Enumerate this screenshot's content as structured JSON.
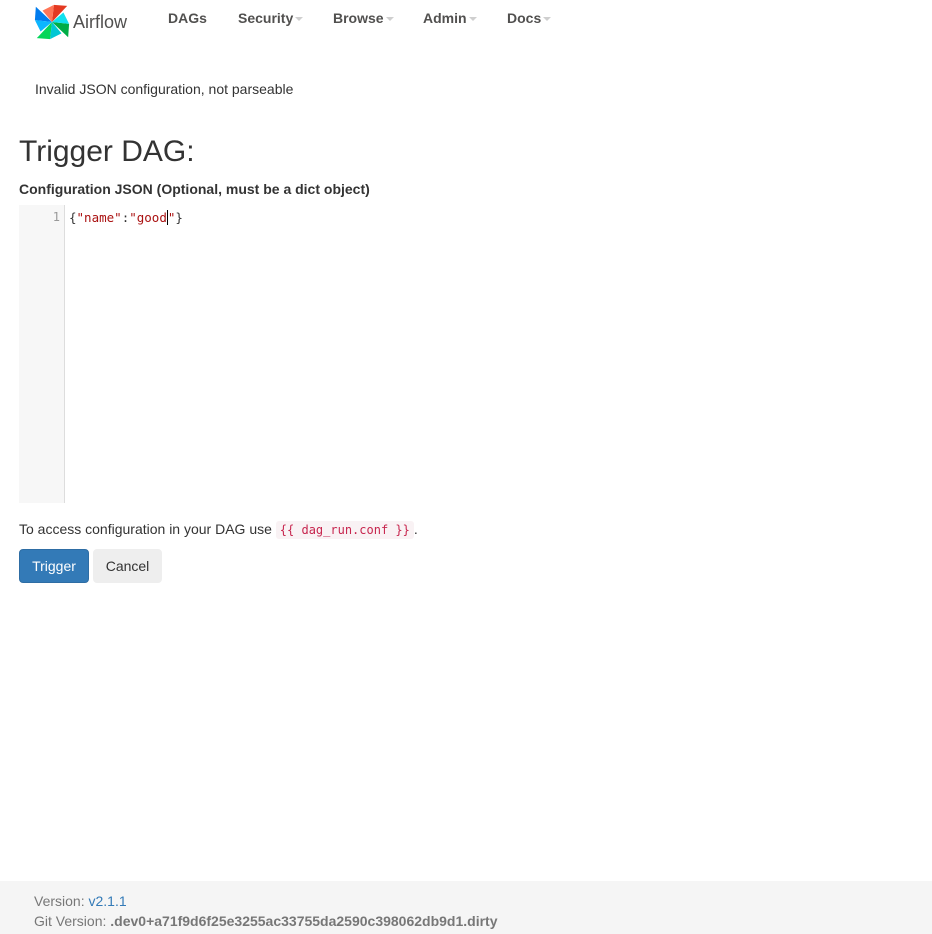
{
  "navbar": {
    "brand": "Airflow",
    "items": [
      {
        "label": "DAGs",
        "dropdown": false
      },
      {
        "label": "Security",
        "dropdown": true
      },
      {
        "label": "Browse",
        "dropdown": true
      },
      {
        "label": "Admin",
        "dropdown": true
      },
      {
        "label": "Docs",
        "dropdown": true
      }
    ]
  },
  "alert": {
    "message": "Invalid JSON configuration, not parseable"
  },
  "page": {
    "title": "Trigger DAG:",
    "config_label": "Configuration JSON (Optional, must be a dict object)"
  },
  "editor": {
    "line_number": "1",
    "tokens": {
      "open": "{",
      "key": "\"name\"",
      "colon": ":",
      "value_before_cursor": "\"good",
      "value_after_cursor": "\"",
      "close": "}"
    }
  },
  "help": {
    "text_before": "To access configuration in your DAG use ",
    "code": "{{ dag_run.conf }}",
    "text_after": "."
  },
  "buttons": {
    "trigger": "Trigger",
    "cancel": "Cancel"
  },
  "footer": {
    "version_label": "Version: ",
    "version_value": "v2.1.1",
    "git_label": "Git Version: ",
    "git_value": ".dev0+a71f9d6f25e3255ac33755da2590c398062db9d1.dirty"
  },
  "colors": {
    "primary": "#337ab7",
    "string_token": "#aa1111",
    "inline_code": "#c7254e",
    "footer_bg": "#f5f5f5"
  }
}
